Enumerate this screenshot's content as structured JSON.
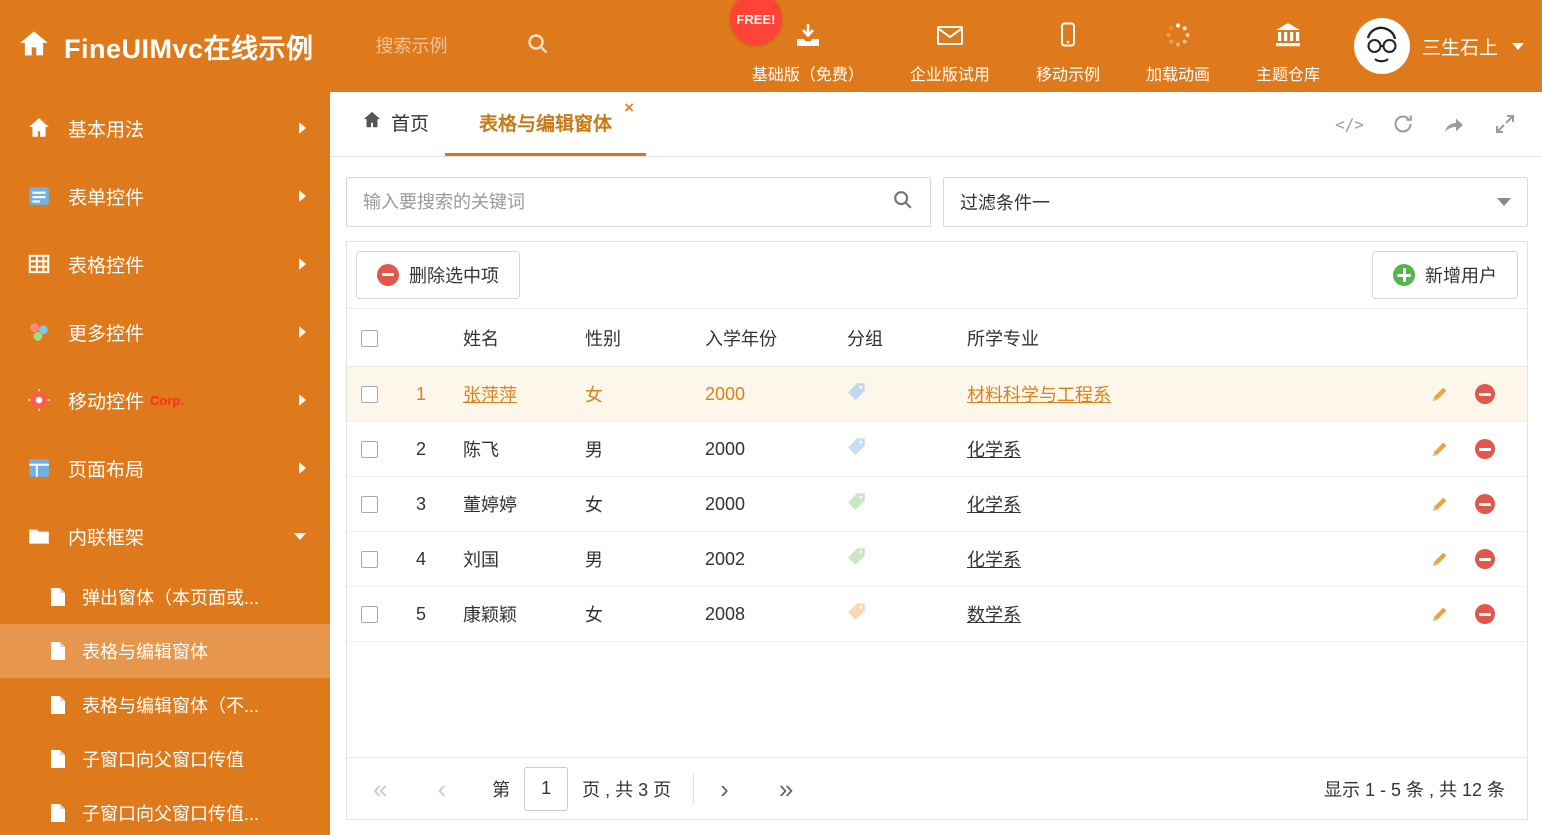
{
  "header": {
    "title": "FineUIMvc在线示例",
    "search_placeholder": "搜索示例",
    "free_badge": "FREE!",
    "nav": [
      {
        "label": "基础版（免费）"
      },
      {
        "label": "企业版试用"
      },
      {
        "label": "移动示例"
      },
      {
        "label": "加载动画"
      },
      {
        "label": "主题仓库"
      }
    ],
    "user_name": "三生石上"
  },
  "sidebar": {
    "items": [
      {
        "label": "基本用法"
      },
      {
        "label": "表单控件"
      },
      {
        "label": "表格控件"
      },
      {
        "label": "更多控件"
      },
      {
        "label": "移动控件",
        "badge": "Corp."
      },
      {
        "label": "页面布局"
      },
      {
        "label": "内联框架",
        "expanded": true
      }
    ],
    "subitems": [
      {
        "label": "弹出窗体（本页面或...",
        "active": false
      },
      {
        "label": "表格与编辑窗体",
        "active": true
      },
      {
        "label": "表格与编辑窗体（不...",
        "active": false
      },
      {
        "label": "子窗口向父窗口传值",
        "active": false
      },
      {
        "label": "子窗口向父窗口传值...",
        "active": false
      }
    ]
  },
  "tabs": {
    "home_label": "首页",
    "active_label": "表格与编辑窗体"
  },
  "filters": {
    "search_placeholder": "输入要搜索的关键词",
    "filter_value": "过滤条件一"
  },
  "toolbar": {
    "delete_label": "删除选中项",
    "add_label": "新增用户"
  },
  "table": {
    "columns": [
      "姓名",
      "性别",
      "入学年份",
      "分组",
      "所学专业"
    ],
    "rows": [
      {
        "num": "1",
        "name": "张萍萍",
        "gender": "女",
        "year": "2000",
        "tag_color": "#7db8e8",
        "major": "材料科学与工程系",
        "selected": true
      },
      {
        "num": "2",
        "name": "陈飞",
        "gender": "男",
        "year": "2000",
        "tag_color": "#7db8e8",
        "major": "化学系",
        "selected": false
      },
      {
        "num": "3",
        "name": "董婷婷",
        "gender": "女",
        "year": "2000",
        "tag_color": "#8fc97a",
        "major": "化学系",
        "selected": false
      },
      {
        "num": "4",
        "name": "刘国",
        "gender": "男",
        "year": "2002",
        "tag_color": "#8fc97a",
        "major": "化学系",
        "selected": false
      },
      {
        "num": "5",
        "name": "康颖颖",
        "gender": "女",
        "year": "2008",
        "tag_color": "#f2a95c",
        "major": "数学系",
        "selected": false
      }
    ]
  },
  "pagination": {
    "page_prefix": "第",
    "current_page": "1",
    "page_suffix": "页 , 共 3 页",
    "summary": "显示 1 - 5 条 , 共 12 条"
  },
  "colors": {
    "theme_orange": "#df7a1c",
    "active_tab_orange": "#c77b17",
    "selected_row_bg": "#fdf6ea",
    "selected_row_text": "#d8821c",
    "free_badge_red": "#ff4336",
    "delete_red": "#e2574c",
    "add_green": "#55b54a",
    "pencil_yellow": "#e9a43c"
  }
}
